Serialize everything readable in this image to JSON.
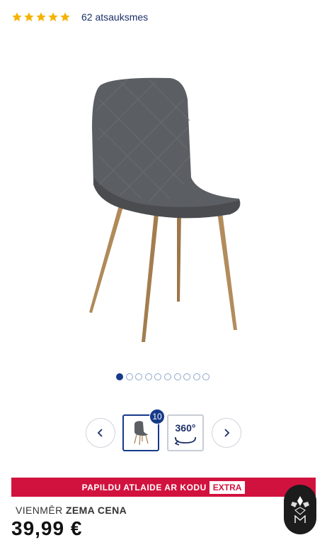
{
  "rating": {
    "stars": 5,
    "star_color": "#f5b301",
    "reviews_text": "62 atsauksmes"
  },
  "gallery": {
    "image_icon": "grey-quilted-chair-with-wooden-legs",
    "dots_total": 10,
    "dots_active_index": 0,
    "thumbnail_count": "10",
    "label_360": "360°",
    "prev_icon": "chevron-left-icon",
    "next_icon": "chevron-right-icon"
  },
  "promo": {
    "text": "PAPILDU ATLAIDE AR KODU",
    "code": "EXTRA",
    "bg_color": "#d2123e"
  },
  "price": {
    "label_light": "VIENMĒR",
    "label_bold": "ZEMA CENA",
    "value": "39,99 €"
  },
  "brand_badge_icon": "brand-logo-icon"
}
